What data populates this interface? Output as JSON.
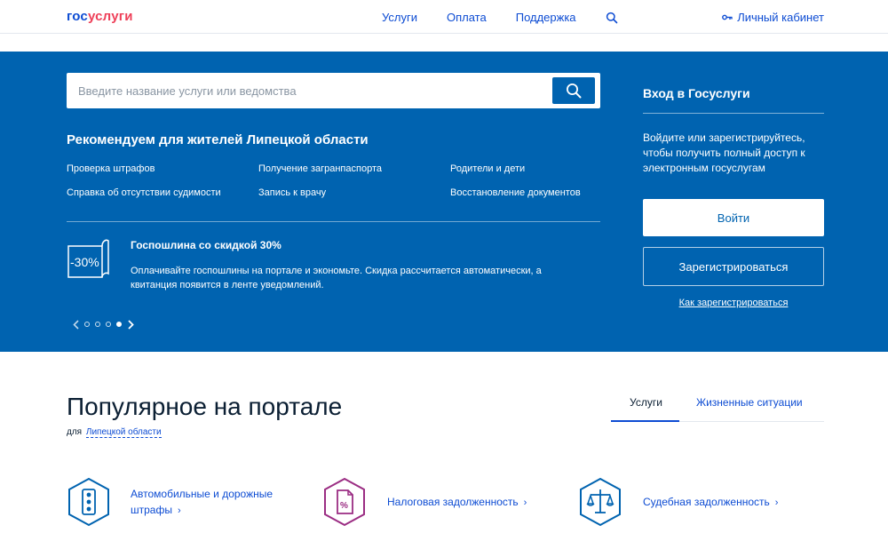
{
  "header": {
    "logo_part1": "гос",
    "logo_part2": "услуги",
    "nav": [
      "Услуги",
      "Оплата",
      "Поддержка"
    ],
    "account_label": "Личный кабинет"
  },
  "search": {
    "placeholder": "Введите название услуги или ведомства"
  },
  "recommendations": {
    "title": "Рекомендуем для жителей Липецкой области",
    "links": [
      "Проверка штрафов",
      "Получение загранпаспорта",
      "Родители и дети",
      "Справка об отсутствии судимости",
      "Запись к врачу",
      "Восстановление документов"
    ]
  },
  "promo": {
    "badge": "-30%",
    "title": "Госпошлина со скидкой 30%",
    "text": "Оплачивайте госпошлины на портале и экономьте. Скидка рассчитается автоматически, а квитанция появится в ленте уведомлений."
  },
  "carousel": {
    "slide_count": 4,
    "active_index": 3
  },
  "login": {
    "title": "Вход в Госуслуги",
    "text": "Войдите или зарегистрируйтесь, чтобы получить полный доступ к электронным госуслугам",
    "login_button": "Войти",
    "register_button": "Зарегистрироваться",
    "how_to_register": "Как зарегистрироваться"
  },
  "popular": {
    "title": "Популярное на портале",
    "for_label": "для",
    "region": "Липецкой области",
    "tabs": [
      "Услуги",
      "Жизненные ситуации"
    ],
    "active_tab": 0,
    "items": [
      {
        "label": "Автомобильные и дорожные штрафы",
        "icon": "traffic-light-icon"
      },
      {
        "label": "Налоговая задолженность",
        "icon": "tax-document-icon"
      },
      {
        "label": "Судебная задолженность",
        "icon": "scales-icon"
      }
    ]
  },
  "colors": {
    "primary": "#0063b0",
    "link": "#0d4cd3",
    "logo_accent": "#ee3f58",
    "tax_icon": "#9b2d83"
  }
}
